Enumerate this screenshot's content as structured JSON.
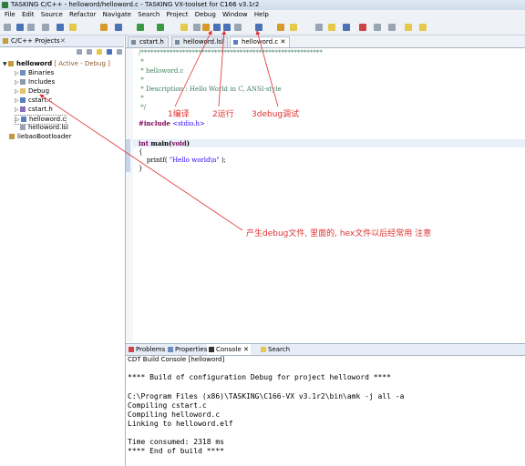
{
  "window": {
    "title": "TASKING C/C++ - helloword/helloword.c - TASKING VX-toolset for C166 v3.1r2"
  },
  "menu": [
    "File",
    "Edit",
    "Source",
    "Refactor",
    "Navigate",
    "Search",
    "Project",
    "Debug",
    "Window",
    "Help"
  ],
  "left_panel": {
    "tab_label": "C/C++ Projects",
    "close": "✕",
    "tree": [
      {
        "label": "helloword",
        "tag": "[ Active - Debug ]"
      },
      {
        "label": "Binaries"
      },
      {
        "label": "Includes"
      },
      {
        "label": "Debug"
      },
      {
        "label": "cstart.c"
      },
      {
        "label": "cstart.h"
      },
      {
        "label": "helloword.c"
      },
      {
        "label": "helloword.lsl"
      },
      {
        "label": "liebaoBootloader"
      }
    ]
  },
  "editor": {
    "tabs": [
      {
        "label": "cstart.h"
      },
      {
        "label": "helloword.lsl"
      },
      {
        "label": "helloword.c",
        "close": "✕"
      }
    ],
    "lines": {
      "l1": "/*********************************************************",
      "l2": " *",
      "l3": " * helloword.c",
      "l4": " *",
      "l5": " * Description : Hello World in C, ANSI-style",
      "l6": " *",
      "l7": " */",
      "inc_kw": "#include",
      "inc_file": "<stdio.h>",
      "main_kw1": "int",
      "main_fn": " main(",
      "main_kw2": "void",
      "main_close": ")",
      "brace_open": "{",
      "printf_pre": "    printf( ",
      "printf_str": "\"Hello world\\n\"",
      "printf_post": " );",
      "brace_close": "}"
    }
  },
  "annotations": {
    "compile": "1编译",
    "run": "2运行",
    "debug": "3debug调试",
    "note": "产生debug文件, 里面的, hex文件以后经常用  注意"
  },
  "bottom": {
    "tabs": [
      {
        "label": "Problems"
      },
      {
        "label": "Properties"
      },
      {
        "label": "Console",
        "close": "✕"
      },
      {
        "label": "Search"
      }
    ],
    "console_title": "CDT Build Console [helloword]",
    "lines": [
      "**** Build of configuration Debug for project helloword ****",
      "",
      "C:\\Program Files (x86)\\TASKING\\C166-VX v3.1r2\\bin\\amk -j all -a",
      "Compiling cstart.c",
      "Compiling helloword.c",
      "Linking to helloword.elf",
      "",
      "Time consumed: 2318 ms",
      "**** End of build ****"
    ]
  },
  "colors": {
    "annotation": "#e03030",
    "comment": "#3f7f5f",
    "keyword": "#7f0055",
    "string": "#2a00ff"
  }
}
